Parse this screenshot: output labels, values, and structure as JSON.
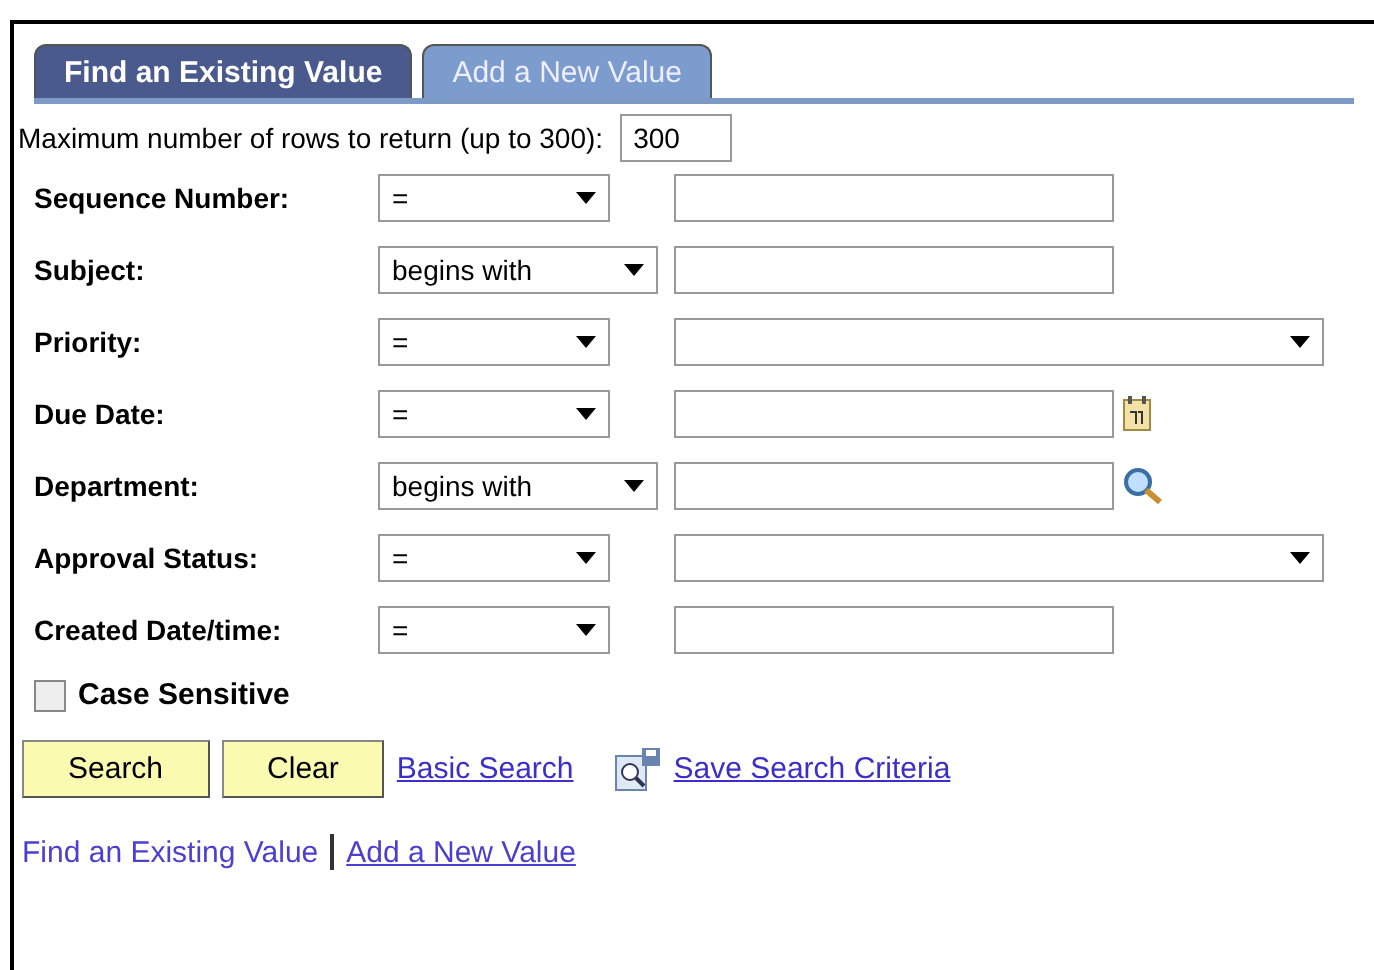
{
  "tabs": [
    {
      "label": "Find an Existing Value",
      "selected": true
    },
    {
      "label": "Add a New Value",
      "selected": false
    }
  ],
  "max_rows": {
    "label": "Maximum number of rows to return (up to 300):",
    "value": "300"
  },
  "criteria": [
    {
      "label": "Sequence Number:",
      "operator": "=",
      "kind": "text"
    },
    {
      "label": "Subject:",
      "operator": "begins with",
      "kind": "text"
    },
    {
      "label": "Priority:",
      "operator": "=",
      "kind": "dropdown"
    },
    {
      "label": "Due Date:",
      "operator": "=",
      "kind": "date"
    },
    {
      "label": "Department:",
      "operator": "begins with",
      "kind": "lookup"
    },
    {
      "label": "Approval Status:",
      "operator": "=",
      "kind": "dropdown"
    },
    {
      "label": "Created Date/time:",
      "operator": "=",
      "kind": "text"
    }
  ],
  "case_sensitive": {
    "label": "Case Sensitive",
    "checked": false
  },
  "buttons": [
    "Search",
    "Clear"
  ],
  "links": [
    "Basic Search",
    "Save Search Criteria"
  ],
  "footer_links": [
    "Find an Existing Value",
    "Add a New Value"
  ]
}
